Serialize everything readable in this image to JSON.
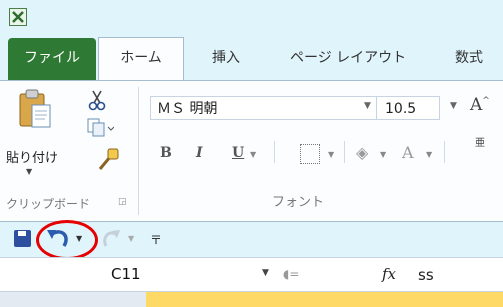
{
  "tabs": {
    "file": "ファイル",
    "home": "ホーム",
    "insert": "挿入",
    "page_layout": "ページ レイアウト",
    "formulas": "数式"
  },
  "clipboard": {
    "paste_label": "貼り付け",
    "group_label": "クリップボード"
  },
  "font": {
    "name": "ＭＳ 明朝",
    "size": "10.5",
    "bold": "B",
    "italic": "I",
    "underline": "U",
    "font_color": "A",
    "grow": "A",
    "phonetic": "亜",
    "group_label": "フォント"
  },
  "formula_bar": {
    "name_box": "C11",
    "fx": "fx",
    "content": "ss"
  },
  "colors": {
    "file_tab": "#2e7a35",
    "background": "#dff4fb",
    "highlight_circle": "#e60000",
    "selected_column": "#ffd966"
  }
}
